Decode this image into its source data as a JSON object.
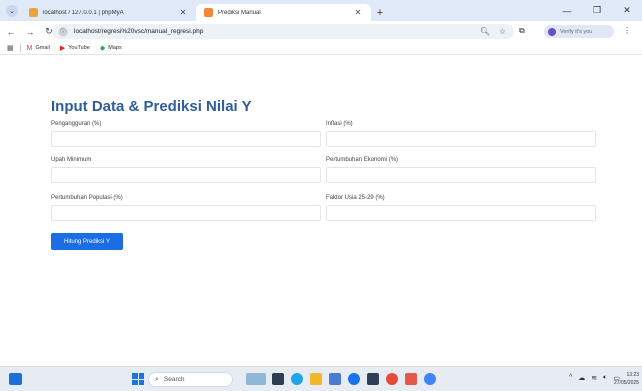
{
  "browser": {
    "tabs": [
      {
        "title": "localhost / 127.0.0.1 | phpMyA",
        "favicon_color": "#e8a33a",
        "active": false
      },
      {
        "title": "Prediksi Manual",
        "favicon_color": "#f0883a",
        "active": true
      }
    ],
    "url": "localhost/regresi%20vsc/manual_regresi.php",
    "profile_label": "Verify it's you",
    "bookmarks": [
      {
        "label": "Gmail",
        "icon": "gmail-icon",
        "color": "#d44638"
      },
      {
        "label": "YouTube",
        "icon": "youtube-icon",
        "color": "#e62117"
      },
      {
        "label": "Maps",
        "icon": "maps-icon",
        "color": "#34a853"
      }
    ]
  },
  "page": {
    "heading": "Input Data & Prediksi Nilai Y",
    "heading_color": "#2f5d99",
    "fields": {
      "pengangguran": {
        "label": "Pengangguran (%)",
        "value": ""
      },
      "inflasi": {
        "label": "Inflasi (%)",
        "value": ""
      },
      "upah": {
        "label": "Upah Minimum",
        "value": ""
      },
      "pertumbuhan_ekonomi": {
        "label": "Pertumbuhan Ekonomi (%)",
        "value": ""
      },
      "pertumbuhan_populasi": {
        "label": "Pertumbuhan Populasi (%)",
        "value": ""
      },
      "faktor_usia": {
        "label": "Faktor Usia 25-29 (%)",
        "value": ""
      }
    },
    "submit_label": "Hitung Prediksi Y",
    "accent": "#1a6de3"
  },
  "taskbar": {
    "search_placeholder": "Search",
    "time": "13:23",
    "date": "27/05/2025"
  }
}
